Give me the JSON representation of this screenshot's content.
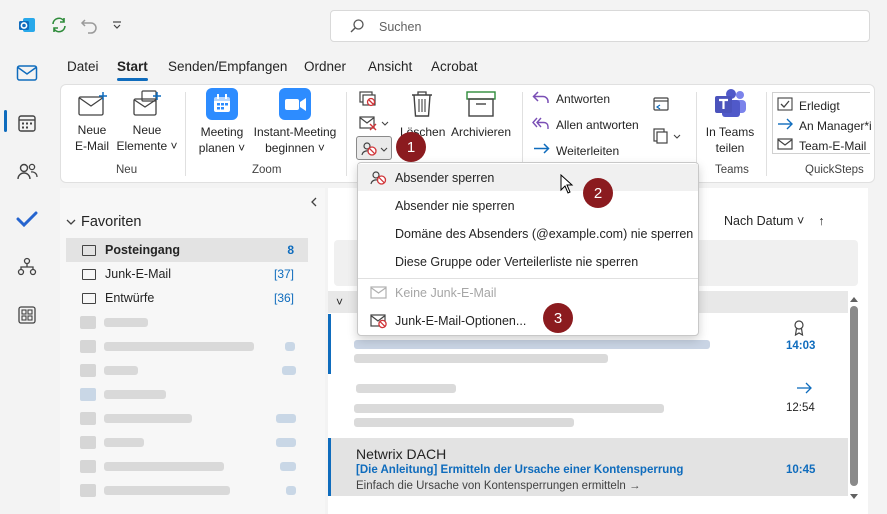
{
  "search": {
    "placeholder": "Suchen"
  },
  "tabs": [
    "Datei",
    "Start",
    "Senden/Empfangen",
    "Ordner",
    "Ansicht",
    "Acrobat"
  ],
  "ribbon": {
    "new_email": [
      "Neue",
      "E-Mail"
    ],
    "new_items": [
      "Neue",
      "Elemente ˅"
    ],
    "group_new": "Neu",
    "meeting": [
      "Meeting",
      "planen ˅"
    ],
    "instant_meeting": [
      "Instant-Meeting",
      "beginnen ˅"
    ],
    "group_zoom": "Zoom",
    "delete": "Löschen",
    "archive": "Archivieren",
    "reply": "Antworten",
    "reply_all": "Allen antworten",
    "forward": "Weiterleiten",
    "teams": [
      "In Teams",
      "teilen"
    ],
    "group_teams": "Teams",
    "qs_done": "Erledigt",
    "qs_manager": "An Manager*i",
    "qs_team": "Team-E-Mail",
    "group_quicksteps": "QuickSteps"
  },
  "folders": {
    "favorites_label": "Favoriten",
    "items": [
      {
        "name": "Posteingang",
        "count": "8",
        "selected": true
      },
      {
        "name": "Junk-E-Mail",
        "count": "[37]",
        "selected": false
      },
      {
        "name": "Entwürfe",
        "count": "[36]",
        "selected": false
      }
    ]
  },
  "messages": {
    "sort_label": "Nach Datum ˅",
    "sort_arrow": "↑",
    "group_header": "˅",
    "items": [
      {
        "time": "14:03"
      },
      {
        "time": "12:54"
      },
      {
        "sender": "Netwrix DACH",
        "subject": "[Die Anleitung] Ermitteln der Ursache einer Kontensperrung",
        "preview": "Einfach die Ursache von Kontensperrungen ermitteln →",
        "time": "10:45"
      }
    ]
  },
  "menu": {
    "items": [
      {
        "label": "Absender sperren",
        "state": "hover"
      },
      {
        "label": "Absender nie sperren",
        "state": "normal"
      },
      {
        "label": "Domäne des Absenders (@example.com) nie sperren",
        "state": "normal"
      },
      {
        "label": "Diese Gruppe oder Verteilerliste nie sperren",
        "state": "normal"
      },
      {
        "label": "Keine Junk-E-Mail",
        "state": "disabled"
      },
      {
        "label": "Junk-E-Mail-Optionen...",
        "state": "normal"
      }
    ]
  },
  "callouts": [
    "1",
    "2",
    "3"
  ],
  "colors": {
    "accent": "#0f6cbd",
    "callout": "#8b1b1f",
    "block_red": "#d13438"
  }
}
